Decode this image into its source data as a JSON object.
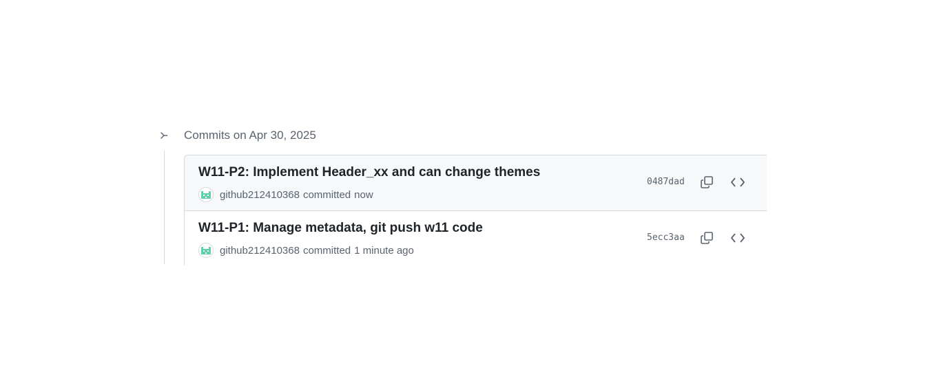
{
  "group": {
    "icon": "git-commit-icon",
    "title": "Commits on Apr 30, 2025"
  },
  "commits": [
    {
      "title": "W11-P2: Implement Header_xx and can change themes",
      "author": "github212410368",
      "verb": "committed",
      "time": "now",
      "sha": "0487dad",
      "copy_icon": "copy-icon",
      "browse_icon": "code-icon"
    },
    {
      "title": "W11-P1: Manage metadata, git push w11 code",
      "author": "github212410368",
      "verb": "committed",
      "time": "1 minute ago",
      "sha": "5ecc3aa",
      "copy_icon": "copy-icon",
      "browse_icon": "code-icon"
    }
  ],
  "colors": {
    "avatar_accent": "#5fd0a8",
    "border": "#d1d9e0",
    "muted_text": "#59636e",
    "row_highlight": "#f6f8fa"
  }
}
